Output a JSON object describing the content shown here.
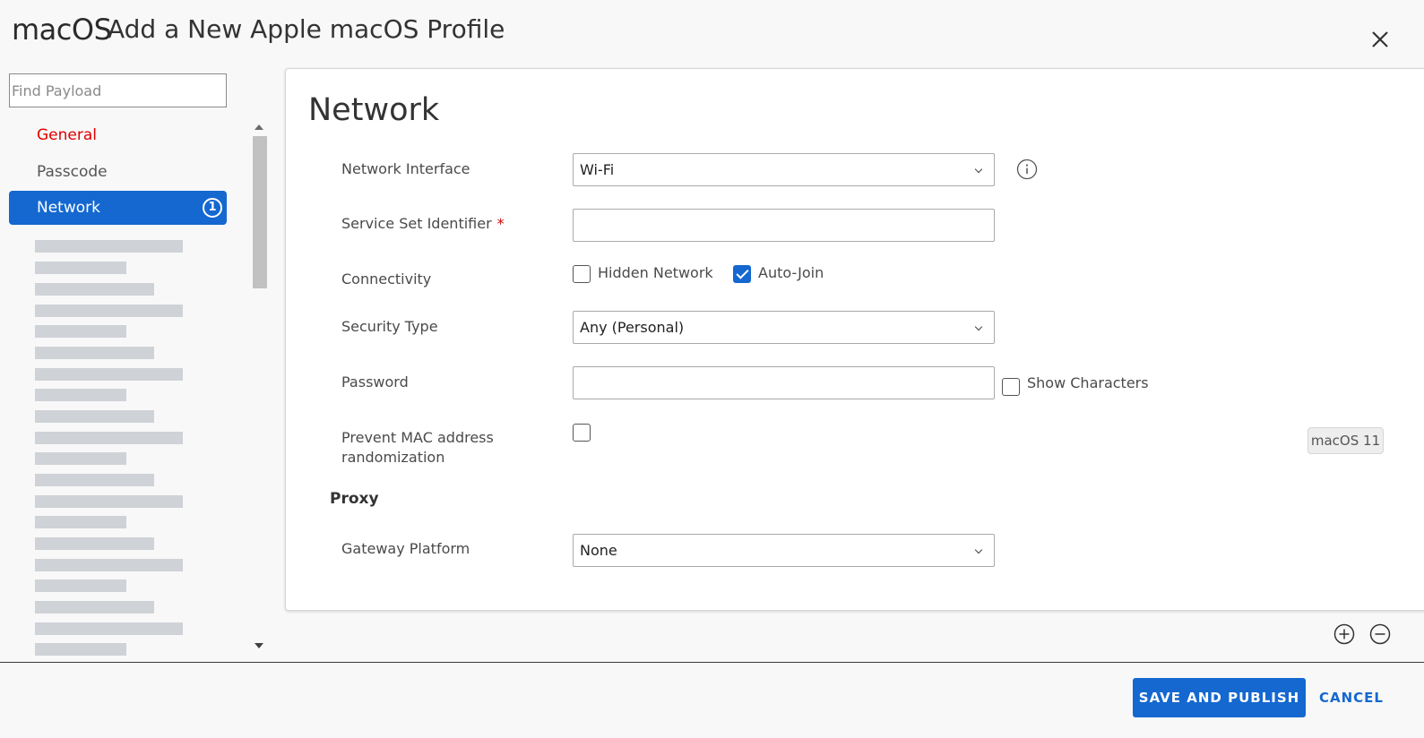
{
  "header": {
    "brand": "macOS",
    "title": "Add a New Apple macOS Profile",
    "close_icon": "close-icon"
  },
  "sidebar": {
    "search_placeholder": "Find Payload",
    "items": [
      {
        "label": "General",
        "state": "error"
      },
      {
        "label": "Passcode",
        "state": "normal"
      },
      {
        "label": "Network",
        "state": "selected",
        "badge": "1"
      }
    ]
  },
  "panel": {
    "title": "Network",
    "fields": {
      "network_interface": {
        "label": "Network Interface",
        "value": "Wi-Fi"
      },
      "ssid": {
        "label": "Service Set Identifier",
        "required_marker": "*",
        "value": ""
      },
      "connectivity": {
        "label": "Connectivity",
        "hidden_network": {
          "label": "Hidden Network",
          "checked": false
        },
        "auto_join": {
          "label": "Auto-Join",
          "checked": true
        }
      },
      "security_type": {
        "label": "Security Type",
        "value": "Any (Personal)"
      },
      "password": {
        "label": "Password",
        "value": "",
        "show_characters": {
          "label": "Show Characters",
          "checked": false
        }
      },
      "prevent_mac": {
        "label_line1": "Prevent MAC address",
        "label_line2": "randomization",
        "checked": false,
        "os_badge": "macOS 11"
      }
    },
    "proxy": {
      "heading": "Proxy",
      "gateway_platform": {
        "label": "Gateway Platform",
        "value": "None"
      }
    }
  },
  "footer": {
    "primary_label": "SAVE AND PUBLISH",
    "cancel_label": "CANCEL"
  },
  "colors": {
    "accent": "#1468d0",
    "error": "#e00000",
    "placeholder_bar": "#cfd2d6"
  }
}
